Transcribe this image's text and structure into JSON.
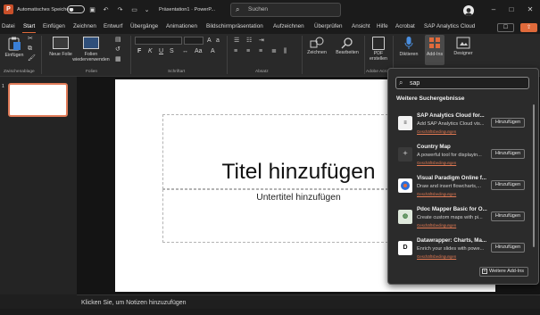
{
  "titlebar": {
    "autosave_label": "Automatisches Speichern",
    "autosave_state": "Aus",
    "document_title": "Präsentation1 · PowerP...",
    "search_placeholder": "Suchen"
  },
  "tabs": [
    "Datei",
    "Start",
    "Einfügen",
    "Zeichnen",
    "Entwurf",
    "Übergänge",
    "Animationen",
    "Bildschirmpräsentation",
    "Aufzeichnen",
    "Überprüfen",
    "Ansicht",
    "Hilfe",
    "Acrobat",
    "SAP Analytics Cloud"
  ],
  "active_tab": "Start",
  "ribbon": {
    "einfuegen_label": "Einfügen",
    "neue_folie_label": "Neue Folie",
    "folien_wiederverwenden_label": "Folien wiederverwenden",
    "zeichnen_label": "Zeichnen",
    "bearbeiten_label": "Bearbeiten",
    "pdf_erstellen_label": "PDF erstellen",
    "diktieren_label": "Diktieren",
    "addins_label": "Add-Ins",
    "designer_label": "Designer",
    "groups": {
      "zwischenablage": "Zwischenablage",
      "folien": "Folien",
      "schriftart": "Schriftart",
      "absatz": "Absatz",
      "adobe": "Adobe Acro"
    }
  },
  "thumbnails": {
    "slide_number": "1"
  },
  "slide": {
    "title_placeholder": "Titel hinzufügen",
    "subtitle_placeholder": "Untertitel hinzufügen"
  },
  "notes": {
    "placeholder": "Klicken Sie, um Notizen hinzuzufügen"
  },
  "addins_popup": {
    "search_value": "sap",
    "heading": "Weitere Suchergebnisse",
    "results": [
      {
        "name": "SAP Analytics Cloud for...",
        "desc": "Add SAP Analytics Cloud vis...",
        "link": "Geschäftsbedingungen",
        "button": "Hinzufügen",
        "icon": "sap-analytics-icon"
      },
      {
        "name": "Country Map",
        "desc": "A powerful tool for displayin...",
        "link": "Geschäftsbedingungen",
        "button": "Hinzufügen",
        "icon": "country-map-icon"
      },
      {
        "name": "Visual Paradigm Online f...",
        "desc": "Draw and insert flowcharts,...",
        "link": "Geschäftsbedingungen",
        "button": "Hinzufügen",
        "icon": "visual-paradigm-icon"
      },
      {
        "name": "Pdoc Mapper Basic for O...",
        "desc": "Create custom maps with pi...",
        "link": "Geschäftsbedingungen",
        "button": "Hinzufügen",
        "icon": "pdoc-mapper-icon"
      },
      {
        "name": "Datawrapper: Charts, Ma...",
        "desc": "Enrich your slides with powe...",
        "link": "Geschäftsbedingungen",
        "button": "Hinzufügen",
        "icon": "datawrapper-icon"
      }
    ],
    "more_button": "Weitere Add-Ins"
  },
  "colors": {
    "accent": "#e06a3b",
    "background": "#1f1f1f",
    "slide": "#ffffff"
  }
}
